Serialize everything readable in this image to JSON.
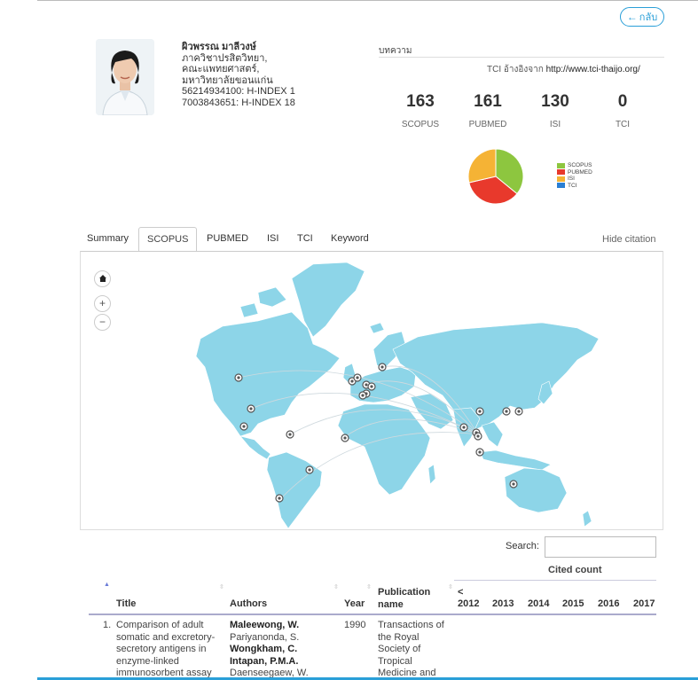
{
  "header": {
    "back_label": "กลับ"
  },
  "profile": {
    "name": "ผิวพรรณ มาลีวงษ์",
    "dept": "ภาควิชาปรสิตวิทยา,",
    "faculty": "คณะแพทยศาสตร์,",
    "university": "มหาวิทยาลัยขอนแก่น",
    "scopus_hindex": "56214934100: H-INDEX 1",
    "scopus_hindex2": "7003843651: H-INDEX 18"
  },
  "articles": {
    "label": "บทความ",
    "tci_ref_prefix": "TCI อ้างอิงจาก",
    "tci_ref_url": "http://www.tci-thaijo.org/"
  },
  "stats": [
    {
      "value": "163",
      "label": "SCOPUS"
    },
    {
      "value": "161",
      "label": "PUBMED"
    },
    {
      "value": "130",
      "label": "ISI"
    },
    {
      "value": "0",
      "label": "TCI"
    }
  ],
  "pie_chart": {
    "slices": [
      {
        "name": "SCOPUS",
        "value": 163,
        "color": "#8dc63f"
      },
      {
        "name": "PUBMED",
        "value": 161,
        "color": "#e8392c"
      },
      {
        "name": "ISI",
        "value": 130,
        "color": "#f5b335"
      },
      {
        "name": "TCI",
        "value": 0,
        "color": "#2a7fd4"
      }
    ]
  },
  "tabs": [
    "Summary",
    "SCOPUS",
    "PUBMED",
    "ISI",
    "TCI",
    "Keyword"
  ],
  "active_tab": "SCOPUS",
  "hide_citation": "Hide citation",
  "map": {
    "land_color": "#8dd5e8",
    "marker_color": "#555555",
    "controls": [
      "home-icon",
      "zoom-in-icon",
      "zoom-out-icon"
    ]
  },
  "search": {
    "label": "Search:",
    "value": ""
  },
  "table": {
    "cited_count_label": "Cited count",
    "columns": [
      "Title",
      "Authors",
      "Year",
      "Publication name"
    ],
    "year_columns": [
      "<\n2012",
      "2013",
      "2014",
      "2015",
      "2016",
      "2017"
    ],
    "rows": [
      {
        "index": "1.",
        "title": "Comparison of adult somatic and excretory-secretory antigens in enzyme-linked immunosorbent assay",
        "authors_bold1": "Maleewong, W.",
        "authors_plain1": "Pariyanonda, S.",
        "authors_bold2": "Wongkham, C. Intapan, P.M.A.",
        "authors_plain2": "Daenseegaew, W.",
        "year": "1990",
        "publication": "Transactions of the Royal Society of Tropical Medicine and"
      }
    ]
  }
}
